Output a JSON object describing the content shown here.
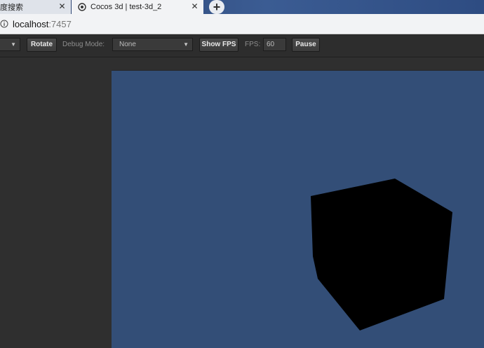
{
  "browser": {
    "tabs": [
      {
        "title": "度搜索",
        "active": false
      },
      {
        "title": "Cocos 3d | test-3d_2",
        "active": true
      }
    ],
    "new_tab_label": "+",
    "close_label": "✕",
    "address": {
      "host": "localhost",
      "port": ":7457"
    }
  },
  "toolbar": {
    "rotate_label": "Rotate",
    "debug_mode_label": "Debug Mode:",
    "debug_mode_value": "None",
    "show_fps_label": "Show FPS",
    "fps_label": "FPS:",
    "fps_value": "60",
    "pause_label": "Pause"
  },
  "colors": {
    "canvas_background": "#334e77",
    "toolbar_background": "#2d2d2d",
    "cube": "#000000"
  },
  "icons": [
    "close-icon",
    "cocos-favicon-icon",
    "plus-icon",
    "info-icon",
    "chevron-down-icon"
  ]
}
